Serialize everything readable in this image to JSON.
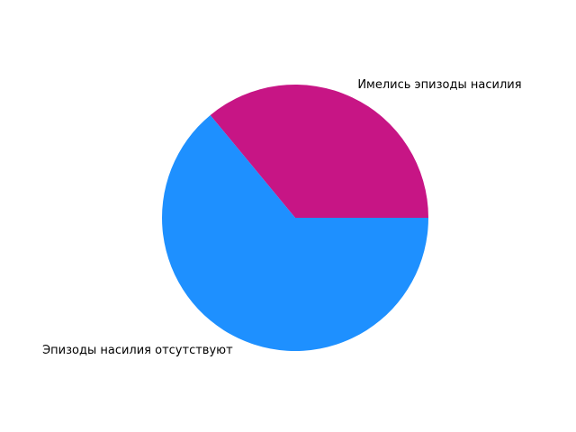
{
  "chart_data": {
    "type": "pie",
    "title": "",
    "start_angle_deg": 0,
    "direction": "counterclockwise",
    "slices": [
      {
        "label": "Имелись эпизоды насилия",
        "value": 36,
        "color": "#c71585"
      },
      {
        "label": "Эпизоды насилия отсутствуют",
        "value": 64,
        "color": "#1e90ff"
      }
    ],
    "legend": "none"
  }
}
